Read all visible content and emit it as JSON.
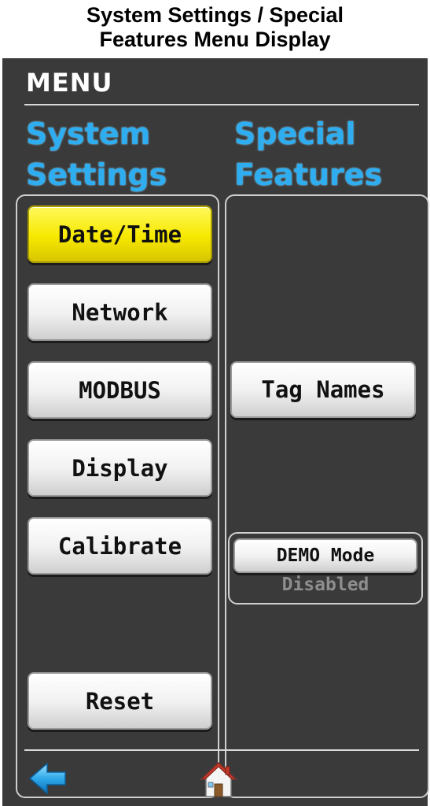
{
  "caption": {
    "line1": "System Settings / Special",
    "line2": "Features Menu Display"
  },
  "menu": {
    "title": "MENU"
  },
  "columns": {
    "system_settings": {
      "line1": "System",
      "line2": "Settings"
    },
    "special_features": {
      "line1": "Special",
      "line2": "Features"
    }
  },
  "system_buttons": [
    {
      "label": "Date/Time",
      "active": true
    },
    {
      "label": "Network",
      "active": false
    },
    {
      "label": "MODBUS",
      "active": false
    },
    {
      "label": "Display",
      "active": false
    },
    {
      "label": "Calibrate",
      "active": false
    },
    {
      "label": "Reset",
      "active": false
    }
  ],
  "special_buttons": {
    "tag_names": "Tag Names",
    "demo_mode": "DEMO Mode",
    "demo_status": "Disabled"
  },
  "nav": {
    "back_icon": "back-arrow-icon",
    "home_icon": "home-icon"
  },
  "colors": {
    "screen_bg": "#3a3a3a",
    "heading_blue": "#2eaef0",
    "active_yellow": "#f6e800",
    "status_gray": "#8e8e8e"
  }
}
